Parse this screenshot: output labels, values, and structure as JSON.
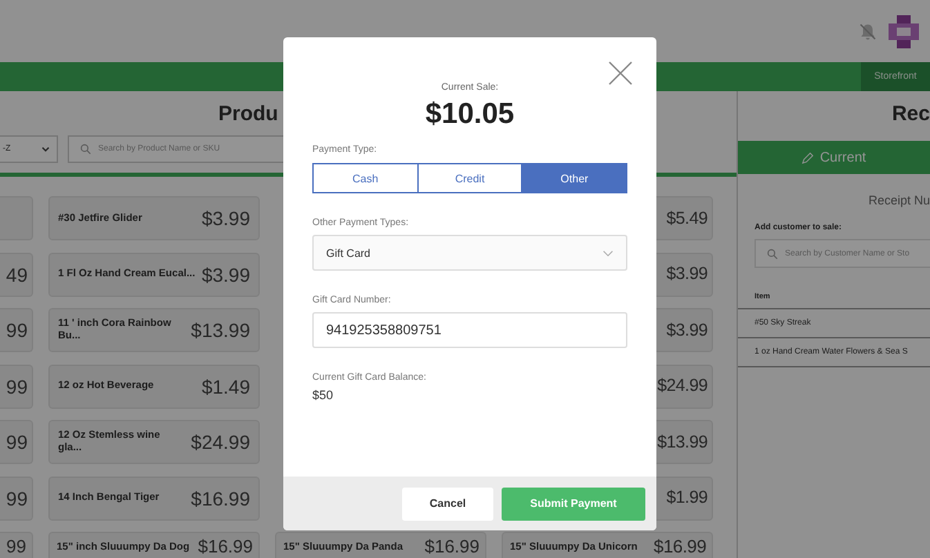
{
  "header": {
    "nav_tabs": [
      {
        "label": "Storefront",
        "selected": true
      }
    ]
  },
  "products": {
    "title": "Produ",
    "sort": "-Z",
    "search": {
      "placeholder": "Search by Product Name or SKU"
    },
    "rows": [
      {
        "cards": [
          {
            "kind": "edge"
          },
          {
            "kind": "left",
            "name": "#30 Jetfire Glider",
            "price": "$3.99"
          },
          {
            "kind": "right",
            "price": "$5.49"
          }
        ]
      },
      {
        "cards": [
          {
            "kind": "edge",
            "price": "49"
          },
          {
            "kind": "left",
            "name": "1 Fl Oz Hand Cream Eucal...",
            "price": "$3.99"
          },
          {
            "kind": "right",
            "price": "$3.99"
          }
        ]
      },
      {
        "cards": [
          {
            "kind": "edge",
            "price": "99"
          },
          {
            "kind": "left",
            "name": "11 ' inch Cora Rainbow Bu...",
            "price": "$13.99"
          },
          {
            "kind": "right",
            "price": "$3.99"
          }
        ]
      },
      {
        "cards": [
          {
            "kind": "edge",
            "price": "99"
          },
          {
            "kind": "left",
            "name": "12 oz Hot Beverage",
            "price": "$1.49"
          },
          {
            "kind": "right",
            "price": "$24.99"
          }
        ]
      },
      {
        "cards": [
          {
            "kind": "edge",
            "price": "99"
          },
          {
            "kind": "left",
            "name": "12 Oz Stemless wine gla...",
            "price": "$24.99"
          },
          {
            "kind": "right",
            "price": "$13.99"
          }
        ]
      },
      {
        "cards": [
          {
            "kind": "edge",
            "price": "99"
          },
          {
            "kind": "left",
            "name": "14 Inch Bengal Tiger",
            "price": "$16.99"
          },
          {
            "kind": "right",
            "price": "$1.99"
          }
        ]
      },
      {
        "cards": [
          {
            "kind": "edge",
            "price": "99"
          },
          {
            "kind": "left",
            "name": "15\" inch Sluuumpy Da Dog",
            "price": "$16.99"
          },
          {
            "kind": "middle",
            "name": "15\" Sluuumpy Da Panda",
            "price": "$16.99"
          },
          {
            "kind": "right",
            "name": "15\" Sluuumpy Da Unicorn",
            "price": "$16.99"
          }
        ]
      }
    ]
  },
  "receipt": {
    "title": "Rec",
    "tabs": [
      {
        "label": "Current",
        "selected": true
      }
    ],
    "receipt_number": "Receipt Nu",
    "customer_label": "Add customer to sale:",
    "customer_search": {
      "placeholder": "Search by Customer Name or Sto"
    },
    "columns": [
      "Item"
    ],
    "items": [
      "#50 Sky Streak",
      "1 oz Hand Cream Water Flowers & Sea S"
    ]
  },
  "modal": {
    "sale_label": "Current Sale:",
    "sale_amount": "$10.05",
    "payment_type_label": "Payment Type:",
    "payment_types": [
      {
        "label": "Cash",
        "selected": false
      },
      {
        "label": "Credit",
        "selected": false
      },
      {
        "label": "Other",
        "selected": true
      }
    ],
    "other_label": "Other Payment Types:",
    "other_value": "Gift Card",
    "card_number_label": "Gift Card Number:",
    "card_number": "941925358809751",
    "balance_label": "Current Gift Card Balance:",
    "balance": "$50",
    "buttons": [
      {
        "label": "Cancel",
        "kind": "secondary"
      },
      {
        "label": "Submit Payment",
        "kind": "primary"
      }
    ]
  }
}
